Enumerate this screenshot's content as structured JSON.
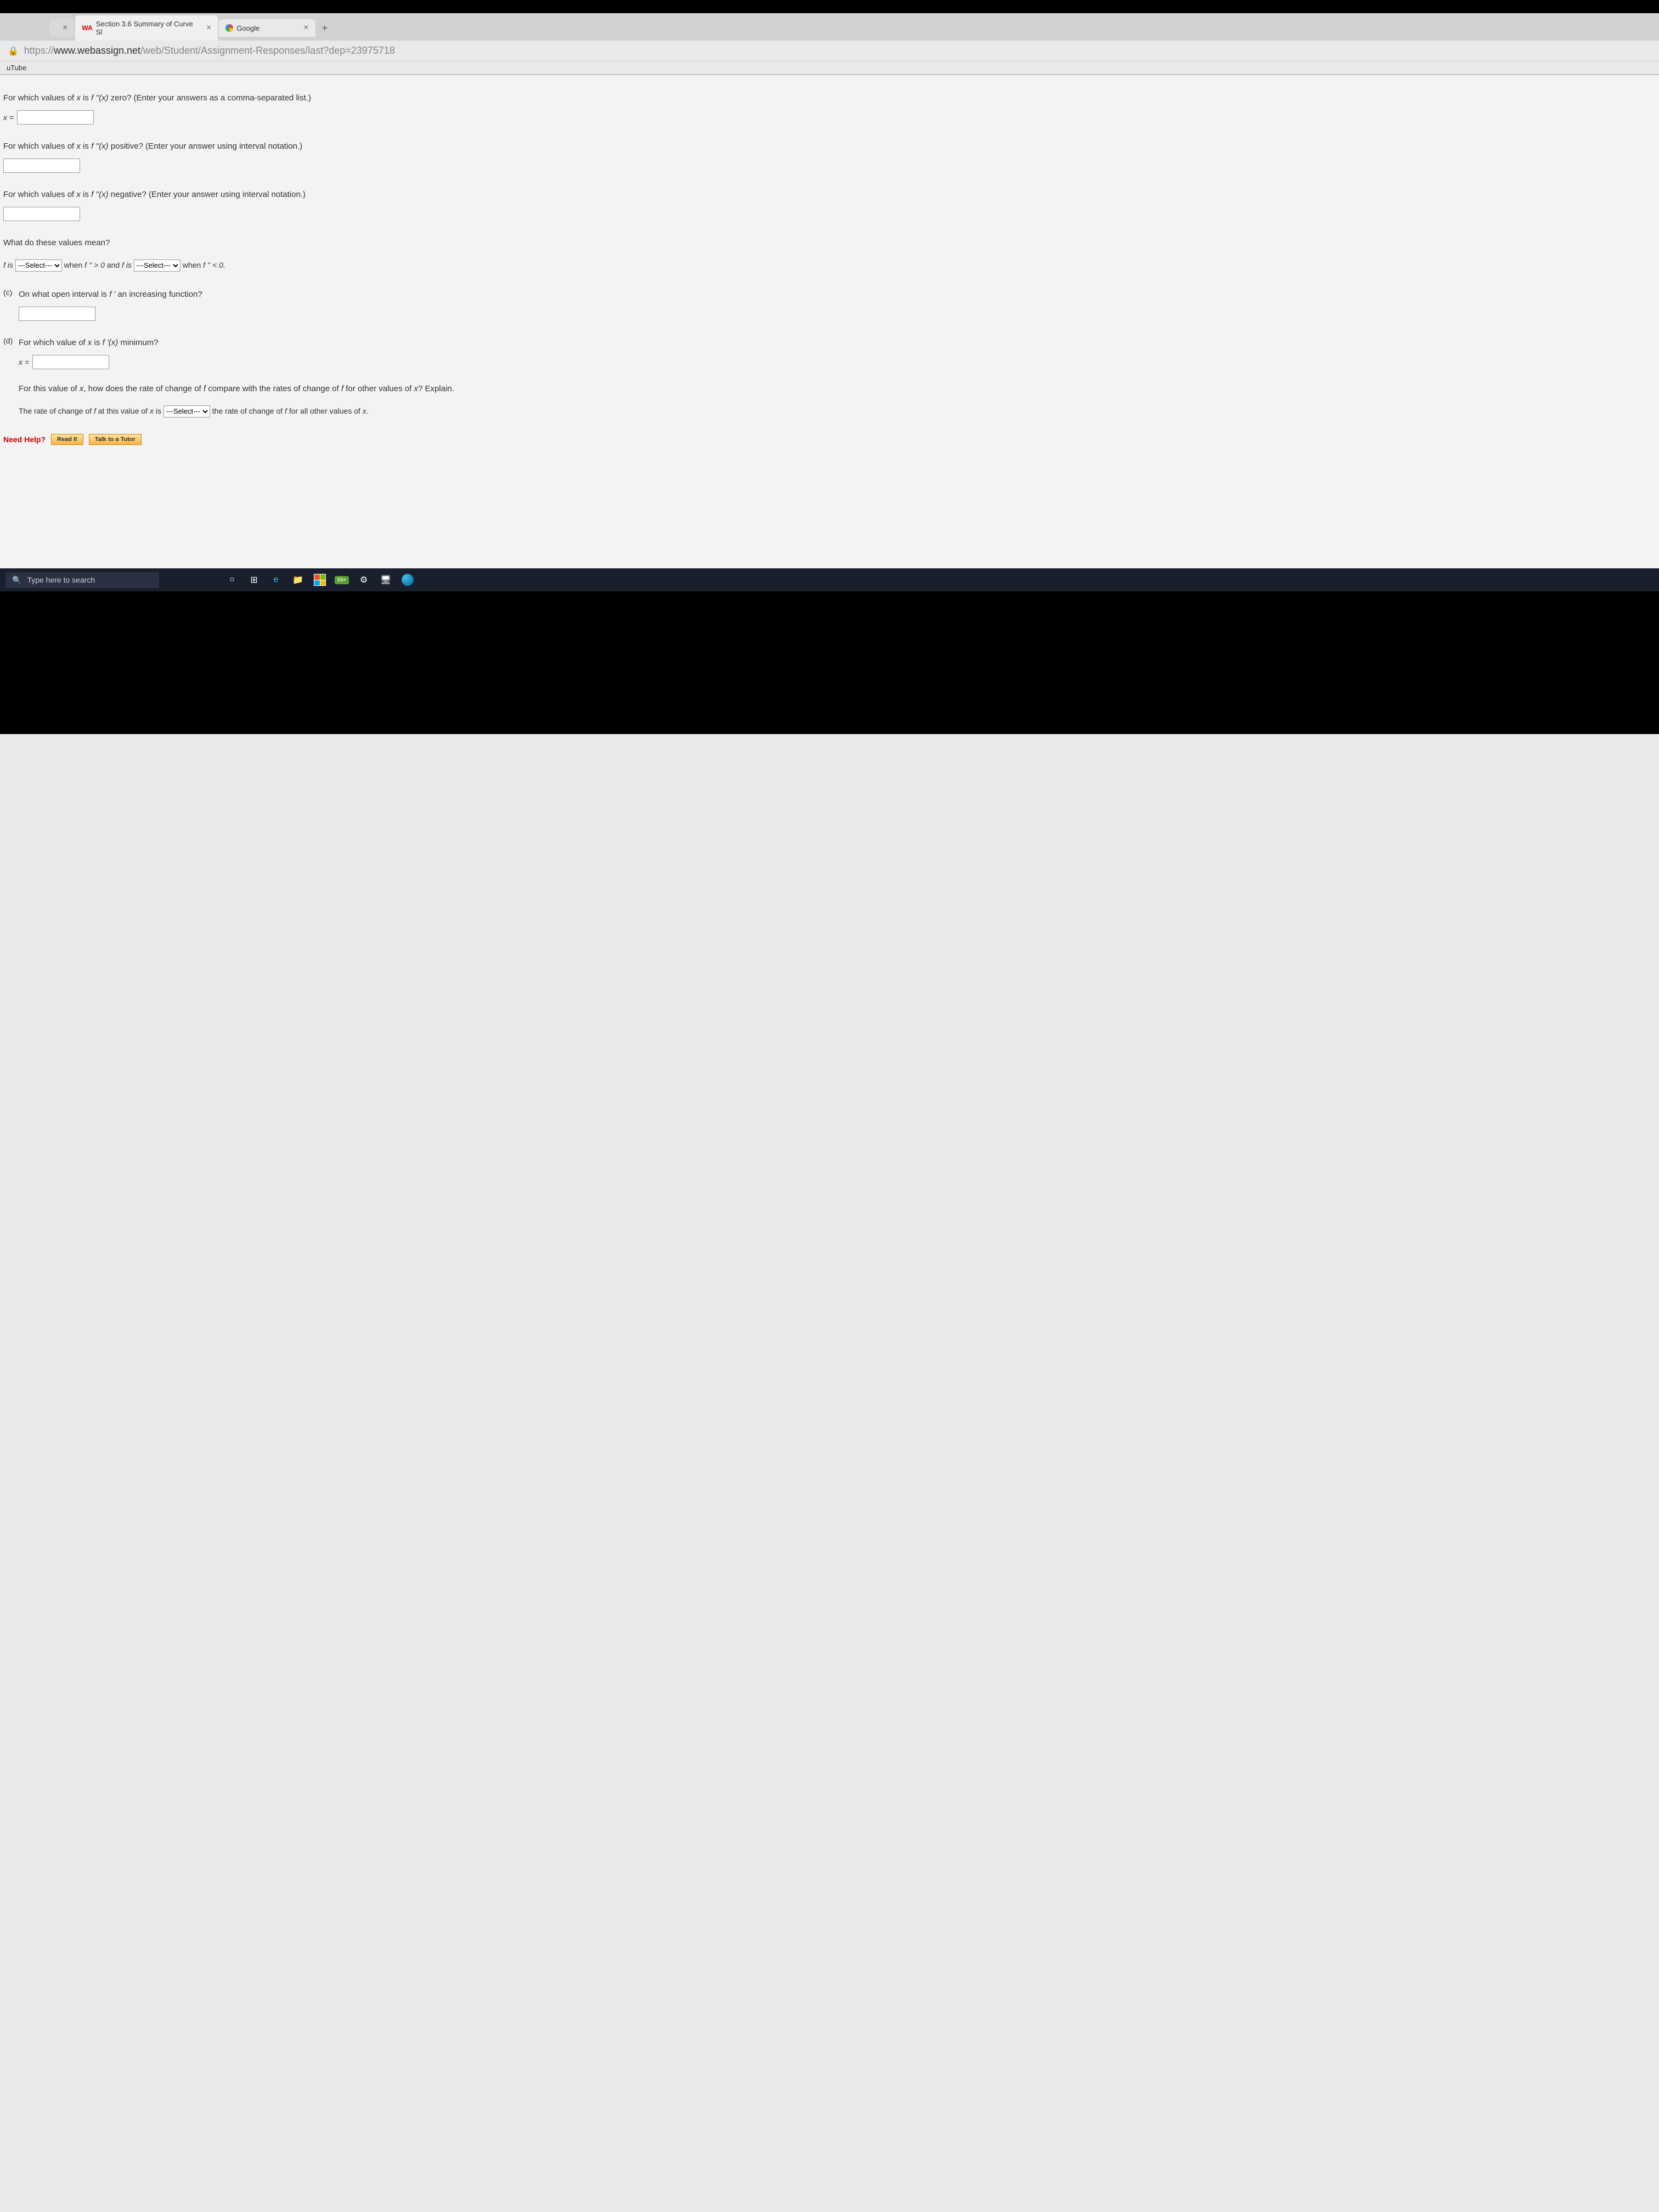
{
  "tabs": {
    "first_close": "×",
    "active": {
      "label": "Section 3.6 Summary of Curve Sl",
      "close": "×",
      "favicon": "WA"
    },
    "google": {
      "label": "Google",
      "close": "×"
    },
    "newtab": "+"
  },
  "url": {
    "prefix": "https://",
    "host": "www.webassign.net",
    "path": "/web/Student/Assignment-Responses/last?dep=23975718"
  },
  "bookmarks": {
    "item1": "uTube"
  },
  "q_zero": {
    "text_a": "For which values of ",
    "var": "x",
    "text_b": " is ",
    "fn": "f ''(x)",
    "text_c": " zero? (Enter your answers as a comma-separated list.)",
    "lbl": "x ="
  },
  "q_pos": {
    "text_a": "For which values of ",
    "var": "x",
    "text_b": " is ",
    "fn": "f ''(x)",
    "text_c": " positive? (Enter your answer using interval notation.)"
  },
  "q_neg": {
    "text_a": "For which values of ",
    "var": "x",
    "text_b": " is ",
    "fn": "f ''(x)",
    "text_c": " negative? (Enter your answer using interval notation.)"
  },
  "q_mean": {
    "heading": "What do these values mean?",
    "t1": "f is ",
    "select": "---Select---",
    "t2": " when ",
    "cond1": "f '' > 0",
    "t3": " and ",
    "t4": "f is ",
    "cond2": "f '' < 0."
  },
  "part_c": {
    "letter": "(c)",
    "text_a": "On what open interval is ",
    "fn": "f '",
    "text_b": " an increasing function?"
  },
  "part_d": {
    "letter": "(d)",
    "text_a": "For which value of ",
    "var": "x",
    "text_b": " is ",
    "fn": "f '(x)",
    "text_c": " minimum?",
    "lbl": "x =",
    "follow_a": "For this value of ",
    "follow_b": ", how does the rate of change of ",
    "follow_c": " compare with the rates of change of ",
    "follow_d": " for other values of ",
    "follow_e": "? Explain.",
    "s1": "The rate of change of ",
    "s2": " at this value of ",
    "s3": " is ",
    "s4": " the rate of change of ",
    "s5": " for all other values of ",
    "f": "f",
    "period": "."
  },
  "help": {
    "label": "Need Help?",
    "read": "Read It",
    "tutor": "Talk to a Tutor"
  },
  "taskbar": {
    "search": "Type here to search",
    "badge": "99+"
  }
}
